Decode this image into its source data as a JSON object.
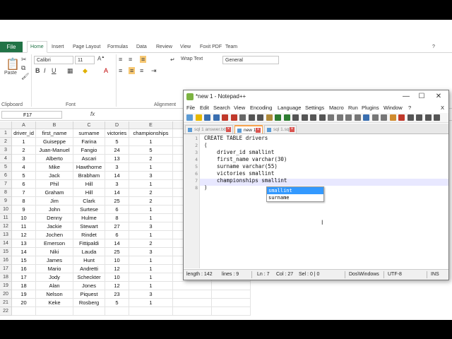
{
  "excel": {
    "file_tab": "File",
    "tabs": [
      "Home",
      "Insert",
      "Page Layout",
      "Formulas",
      "Data",
      "Review",
      "View",
      "Foxit PDF",
      "Team"
    ],
    "font_name": "Calibri",
    "font_size": "11",
    "wrap_text": "Wrap Text",
    "number_format": "General",
    "paste_label": "Paste",
    "groups": {
      "clipboard": "Clipboard",
      "font": "Font",
      "alignment": "Alignment"
    },
    "name_box": "F17",
    "fx": "fx",
    "columns": [
      "A",
      "B",
      "C",
      "D",
      "E"
    ],
    "rows": [
      [
        "driver_id",
        "first_name",
        "surname",
        "victories",
        "championships"
      ],
      [
        "1",
        "Guiseppe",
        "Farina",
        "5",
        "1"
      ],
      [
        "2",
        "Juan-Manuel",
        "Fangio",
        "24",
        "5"
      ],
      [
        "3",
        "Alberto",
        "Ascari",
        "13",
        "2"
      ],
      [
        "4",
        "Mike",
        "Hawthorne",
        "3",
        "1"
      ],
      [
        "5",
        "Jack",
        "Brabham",
        "14",
        "3"
      ],
      [
        "6",
        "Phil",
        "Hill",
        "3",
        "1"
      ],
      [
        "7",
        "Graham",
        "Hill",
        "14",
        "2"
      ],
      [
        "8",
        "Jim",
        "Clark",
        "25",
        "2"
      ],
      [
        "9",
        "John",
        "Surtese",
        "6",
        "1"
      ],
      [
        "10",
        "Denny",
        "Hulme",
        "8",
        "1"
      ],
      [
        "11",
        "Jackie",
        "Stewart",
        "27",
        "3"
      ],
      [
        "12",
        "Jochen",
        "Rindet",
        "6",
        "1"
      ],
      [
        "13",
        "Emerson",
        "Fittipaldi",
        "14",
        "2"
      ],
      [
        "14",
        "Niki",
        "Lauda",
        "25",
        "3"
      ],
      [
        "15",
        "James",
        "Hunt",
        "10",
        "1"
      ],
      [
        "16",
        "Mario",
        "Andretti",
        "12",
        "1"
      ],
      [
        "17",
        "Jody",
        "Scheckter",
        "10",
        "1"
      ],
      [
        "18",
        "Alan",
        "Jones",
        "12",
        "1"
      ],
      [
        "19",
        "Nelson",
        "Piquest",
        "23",
        "3"
      ],
      [
        "20",
        "Keke",
        "Rosberg",
        "5",
        "1"
      ]
    ],
    "row_numbers": [
      "1",
      "2",
      "3",
      "4",
      "5",
      "6",
      "7",
      "8",
      "9",
      "10",
      "11",
      "12",
      "13",
      "14",
      "15",
      "16",
      "17",
      "18",
      "19",
      "20",
      "21",
      "22"
    ]
  },
  "notepad": {
    "title": "*new 1 - Notepad++",
    "menu": [
      "File",
      "Edit",
      "Search",
      "View",
      "Encoding",
      "Language",
      "Settings",
      "Macro",
      "Run",
      "Plugins",
      "Window",
      "?"
    ],
    "close_menu": "X",
    "tabs": [
      "sql 1 answer.txt",
      "new 1",
      "sql 1.sql"
    ],
    "active_tab": "new 1",
    "line_numbers": [
      "1",
      "2",
      "3",
      "4",
      "5",
      "6",
      "7",
      "8"
    ],
    "code_lines": [
      "CREATE TABLE drivers",
      "(",
      "    driver_id smallint",
      "    first_name varchar(30)",
      "    surname varchar(55)",
      "    victories smallint",
      "    championships smallint",
      ")"
    ],
    "autocomplete": [
      "smallint",
      "surname"
    ],
    "status": {
      "length": "length : 142",
      "lines": "lines : 9",
      "ln": "Ln : 7",
      "col": "Col : 27",
      "sel": "Sel : 0 | 0",
      "eol": "Dos\\Windows",
      "encoding": "UTF-8",
      "mode": "INS"
    }
  },
  "colors": {
    "excel_green": "#217346",
    "npp_tab_accent": "#f7a34b",
    "autocomplete_highlight": "#3399ff"
  }
}
